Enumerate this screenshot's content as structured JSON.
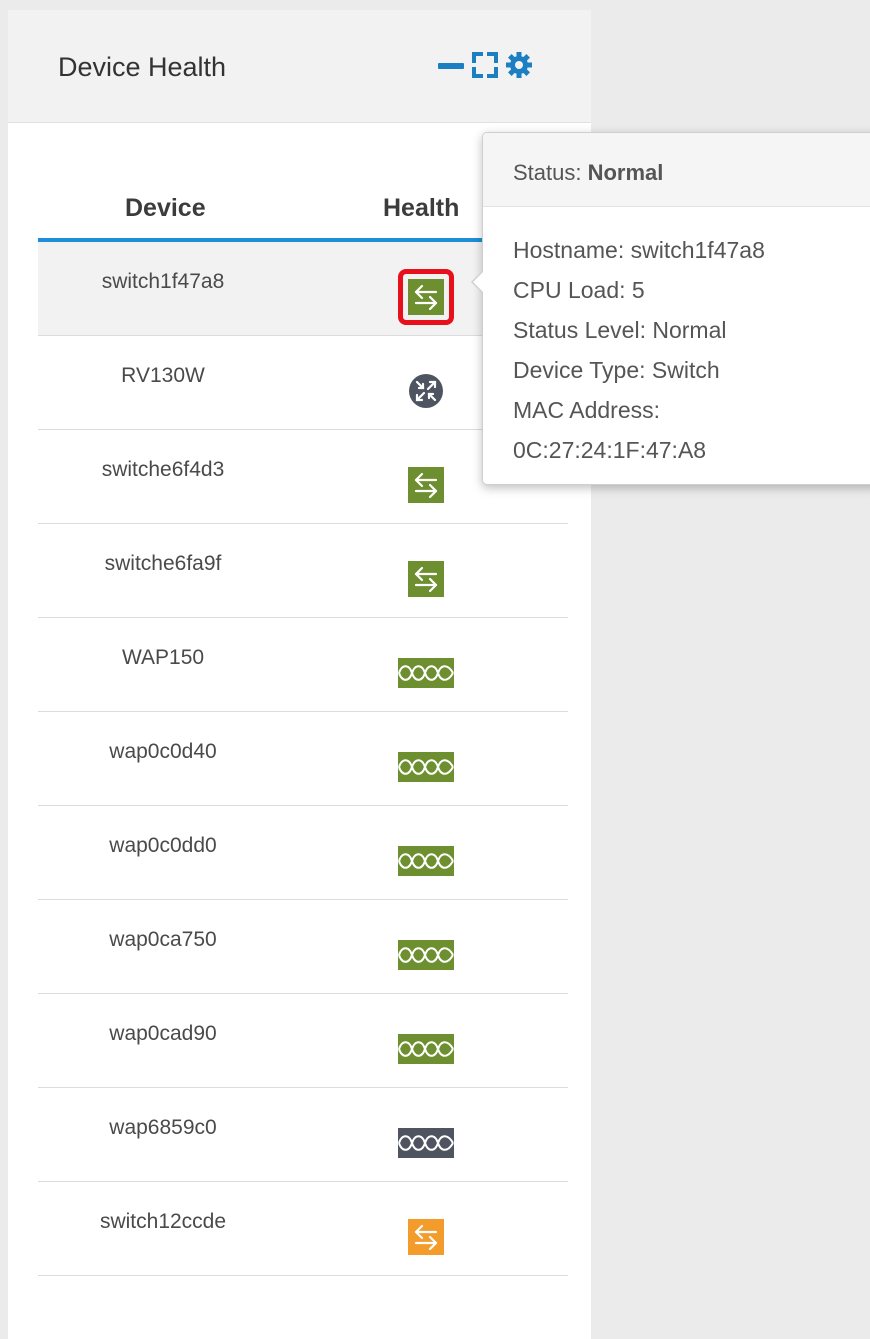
{
  "panel": {
    "title": "Device Health",
    "tools": [
      "minimize-icon",
      "expand-icon",
      "gear-icon"
    ]
  },
  "table": {
    "columns": [
      "Device",
      "Health"
    ],
    "rows": [
      {
        "name": "switch1f47a8",
        "type": "switch",
        "status": "normal",
        "selected": true
      },
      {
        "name": "RV130W",
        "type": "router",
        "status": "offline"
      },
      {
        "name": "switche6f4d3",
        "type": "switch",
        "status": "normal"
      },
      {
        "name": "switche6fa9f",
        "type": "switch",
        "status": "normal"
      },
      {
        "name": "WAP150",
        "type": "wap",
        "status": "normal"
      },
      {
        "name": "wap0c0d40",
        "type": "wap",
        "status": "normal"
      },
      {
        "name": "wap0c0dd0",
        "type": "wap",
        "status": "normal"
      },
      {
        "name": "wap0ca750",
        "type": "wap",
        "status": "normal"
      },
      {
        "name": "wap0cad90",
        "type": "wap",
        "status": "normal"
      },
      {
        "name": "wap6859c0",
        "type": "wap",
        "status": "offline"
      },
      {
        "name": "switch12ccde",
        "type": "switch",
        "status": "warning"
      }
    ]
  },
  "tooltip": {
    "status_label": "Status:",
    "status_value": "Normal",
    "lines": [
      "Hostname: switch1f47a8",
      "CPU Load: 5",
      "Status Level: Normal",
      "Device Type: Switch",
      "MAC Address:",
      "0C:27:24:1F:47:A8"
    ]
  },
  "colors": {
    "normal": "#6d8f2f",
    "offline": "#4e5560",
    "warning": "#f39c2c",
    "accent": "#1c8fd7",
    "highlight": "#e8101a"
  }
}
